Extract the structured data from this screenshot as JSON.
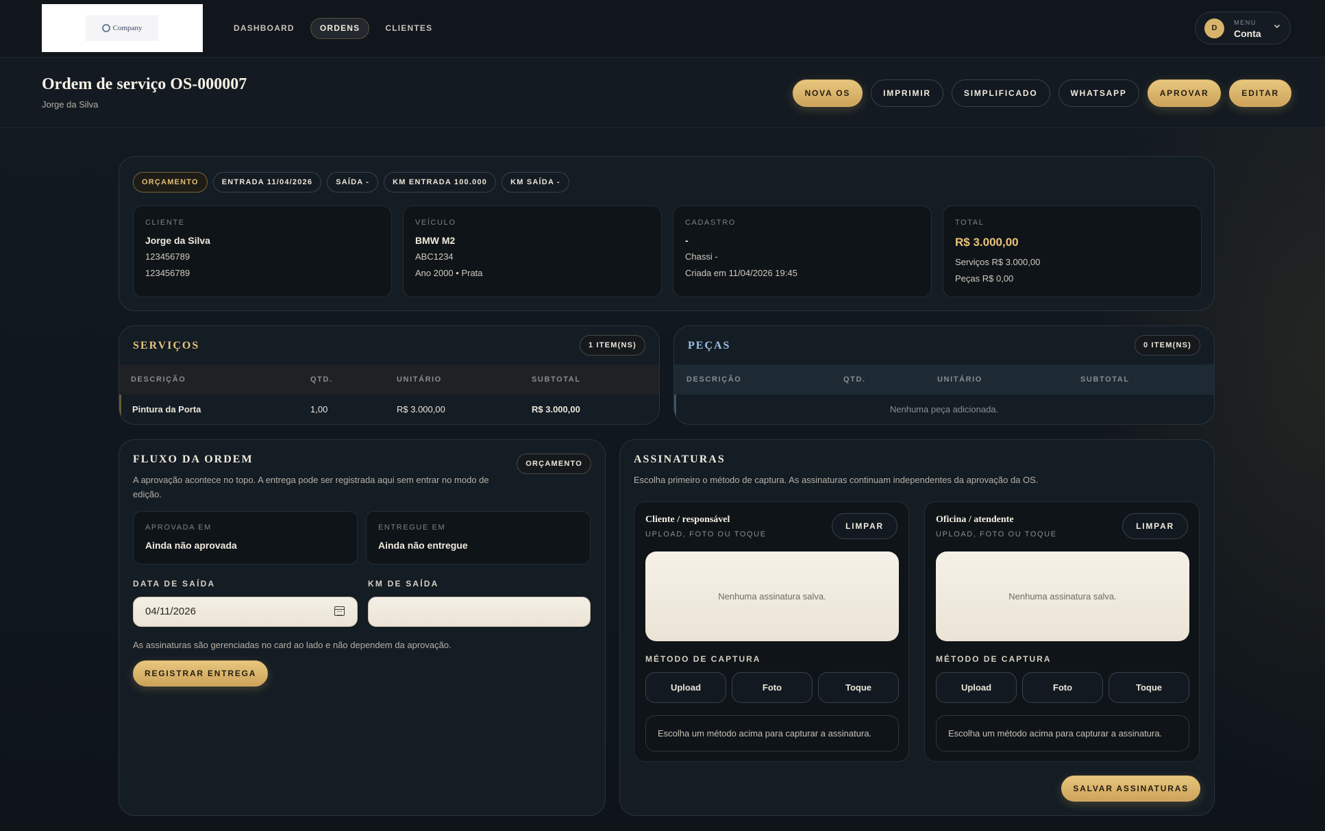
{
  "topbar": {
    "logo_text": "Company",
    "nav": [
      {
        "label": "DASHBOARD",
        "active": false
      },
      {
        "label": "ORDENS",
        "active": true
      },
      {
        "label": "CLIENTES",
        "active": false
      }
    ],
    "account": {
      "initial": "D",
      "menu_label": "MENU",
      "name": "Conta",
      "chevron_icon": "chevron-down-icon"
    }
  },
  "header": {
    "title": "Ordem de serviço OS-000007",
    "subtitle": "Jorge da Silva",
    "actions": [
      {
        "label": "NOVA OS",
        "style": "gold"
      },
      {
        "label": "IMPRIMIR",
        "style": "outline"
      },
      {
        "label": "SIMPLIFICADO",
        "style": "outline"
      },
      {
        "label": "WHATSAPP",
        "style": "outline"
      },
      {
        "label": "APROVAR",
        "style": "gold"
      },
      {
        "label": "EDITAR",
        "style": "gold"
      }
    ]
  },
  "summary": {
    "chips": [
      {
        "label": "ORÇAMENTO",
        "style": "gold"
      },
      {
        "label": "ENTRADA 11/04/2026",
        "style": "plain"
      },
      {
        "label": "SAÍDA -",
        "style": "plain"
      },
      {
        "label": "KM ENTRADA 100.000",
        "style": "plain"
      },
      {
        "label": "KM SAÍDA -",
        "style": "plain"
      }
    ],
    "cliente": {
      "label": "CLIENTE",
      "name": "Jorge da Silva",
      "line2": "123456789",
      "line3": "123456789"
    },
    "veiculo": {
      "label": "VEÍCULO",
      "name": "BMW M2",
      "line2": "ABC1234",
      "line3": "Ano 2000 • Prata"
    },
    "cadastro": {
      "label": "CADASTRO",
      "name": "-",
      "line2": "Chassi -",
      "line3": "Criada em 11/04/2026 19:45"
    },
    "total": {
      "label": "TOTAL",
      "value": "R$ 3.000,00",
      "servicos": "Serviços R$ 3.000,00",
      "pecas": "Peças R$ 0,00"
    }
  },
  "servicos": {
    "title": "SERVIÇOS",
    "count": "1 ITEM(NS)",
    "columns": [
      "DESCRIÇÃO",
      "QTD.",
      "UNITÁRIO",
      "SUBTOTAL"
    ],
    "rows": [
      {
        "descricao": "Pintura da Porta",
        "qtd": "1,00",
        "unitario": "R$ 3.000,00",
        "subtotal": "R$ 3.000,00"
      }
    ]
  },
  "pecas": {
    "title": "PEÇAS",
    "count": "0 ITEM(NS)",
    "columns": [
      "DESCRIÇÃO",
      "QTD.",
      "UNITÁRIO",
      "SUBTOTAL"
    ],
    "empty": "Nenhuma peça adicionada."
  },
  "fluxo": {
    "title": "FLUXO DA ORDEM",
    "status": "ORÇAMENTO",
    "description": "A aprovação acontece no topo. A entrega pode ser registrada aqui sem entrar no modo de edição.",
    "aprovada": {
      "label": "APROVADA EM",
      "value": "Ainda não aprovada"
    },
    "entregue": {
      "label": "ENTREGUE EM",
      "value": "Ainda não entregue"
    },
    "data_saida": {
      "label": "DATA DE SAÍDA",
      "value": "04/11/2026"
    },
    "km_saida": {
      "label": "KM DE SAÍDA",
      "value": ""
    },
    "note": "As assinaturas são gerenciadas no card ao lado e não dependem da aprovação.",
    "register_button": "REGISTRAR ENTREGA"
  },
  "assinaturas": {
    "title": "ASSINATURAS",
    "description": "Escolha primeiro o método de captura. As assinaturas continuam independentes da aprovação da OS.",
    "panels": [
      {
        "title": "Cliente / responsável",
        "subtitle": "UPLOAD, FOTO OU TOQUE",
        "clear": "LIMPAR",
        "empty": "Nenhuma assinatura salva.",
        "method_label": "MÉTODO DE CAPTURA",
        "methods": [
          "Upload",
          "Foto",
          "Toque"
        ],
        "hint": "Escolha um método acima para capturar a assinatura."
      },
      {
        "title": "Oficina / atendente",
        "subtitle": "UPLOAD, FOTO OU TOQUE",
        "clear": "LIMPAR",
        "empty": "Nenhuma assinatura salva.",
        "method_label": "MÉTODO DE CAPTURA",
        "methods": [
          "Upload",
          "Foto",
          "Toque"
        ],
        "hint": "Escolha um método acima para capturar a assinatura."
      }
    ],
    "save_button": "SALVAR ASSINATURAS"
  },
  "colors": {
    "accent_gold": "#d8b46a",
    "background": "#0f151b"
  }
}
